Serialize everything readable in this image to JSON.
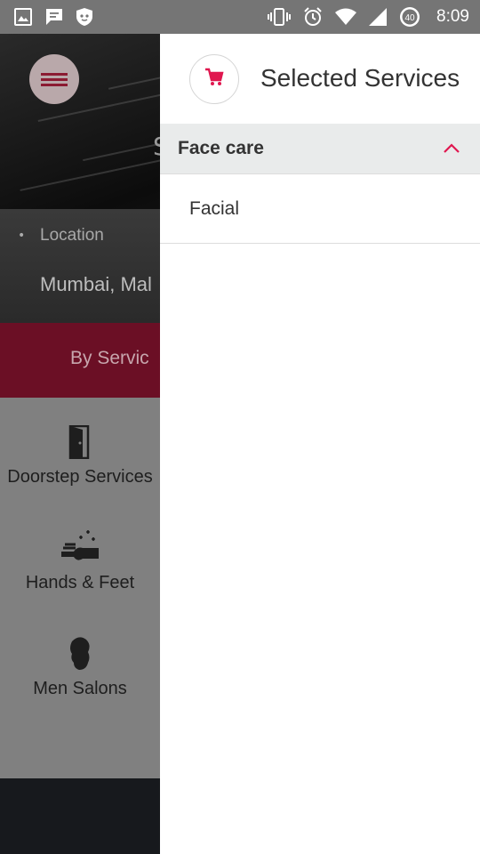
{
  "status_bar": {
    "left_icons": [
      "image-icon",
      "message-icon",
      "shield-face-icon"
    ],
    "right_icons": [
      "vibrate-icon",
      "alarm-icon",
      "wifi-icon",
      "signal-icon",
      "battery-icon"
    ],
    "battery_level": "40",
    "time": "8:09"
  },
  "background": {
    "hero_title": "S",
    "location_label": "Location",
    "location_value": "Mumbai, Mal",
    "service_tab": "By Servic",
    "categories": [
      {
        "label": "Doorstep Services",
        "icon": "door-icon"
      },
      {
        "label": "Hands & Feet",
        "icon": "hands-icon"
      },
      {
        "label": "Men Salons",
        "icon": "men-head-icon"
      }
    ]
  },
  "drawer": {
    "title": "Selected Services",
    "sections": [
      {
        "title": "Face care",
        "expanded": true,
        "items": [
          "Facial"
        ]
      }
    ]
  },
  "colors": {
    "accent": "#e0174f",
    "status_bar": "#757575",
    "section_bg": "#e9ebeb",
    "brand_dark": "#6b0f25"
  }
}
